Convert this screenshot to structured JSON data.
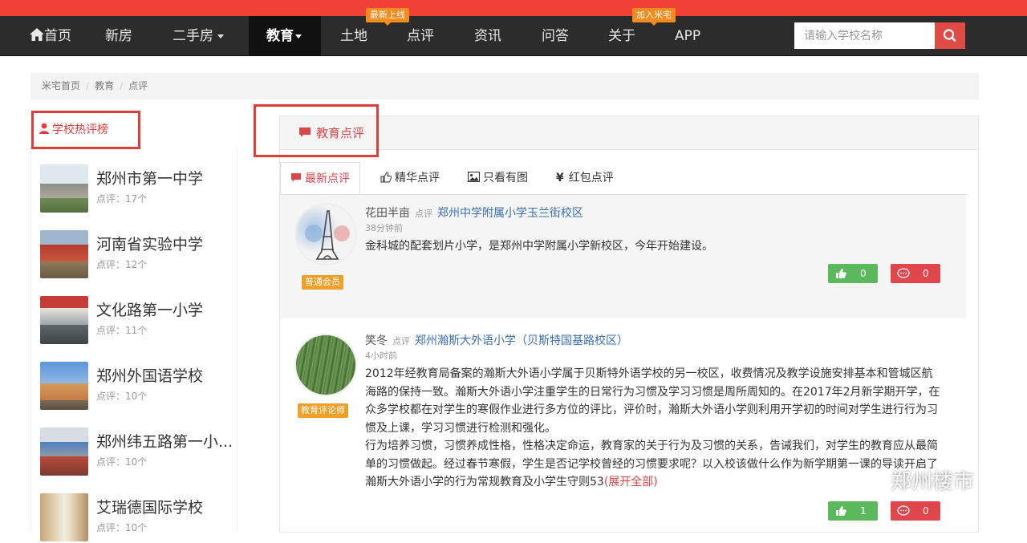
{
  "nav": {
    "home": "首页",
    "items": [
      "新房",
      "二手房",
      "教育",
      "土地",
      "点评",
      "资讯",
      "问答",
      "关于",
      "APP"
    ],
    "badges": {
      "tudi": "最新上线",
      "guanyu": "加入米宅"
    },
    "search_placeholder": "请输入学校名称"
  },
  "breadcrumb": [
    "米宅首页",
    "教育",
    "点评"
  ],
  "left": {
    "tab_label": "学校热评榜",
    "schools": [
      {
        "name": "郑州市第一中学",
        "count": "点评：17个"
      },
      {
        "name": "河南省实验中学",
        "count": "点评：12个"
      },
      {
        "name": "文化路第一小学",
        "count": "点评：11个"
      },
      {
        "name": "郑州外国语学校",
        "count": "点评：10个"
      },
      {
        "name": "郑州纬五路第一小...",
        "count": "点评：10个"
      },
      {
        "name": "艾瑞德国际学校",
        "count": "点评：10个"
      }
    ]
  },
  "right": {
    "tab_label": "教育点评",
    "subtabs": [
      "最新点评",
      "精华点评",
      "只看有图",
      "红包点评"
    ],
    "reviews": [
      {
        "user": "花田半亩",
        "tag": "点评",
        "school": "郑州中学附属小学玉兰街校区",
        "time": "38分钟前",
        "text": "金科城的配套划片小学，是郑州中学附属小学新校区，今年开始建设。",
        "role": "普通会员",
        "likes": "0",
        "comments": "0"
      },
      {
        "user": "笑冬",
        "tag": "点评",
        "school": "郑州瀚斯大外语小学（贝斯特国基路校区）",
        "time": "4小时前",
        "text": "2012年经教育局备案的瀚斯大外语小学属于贝斯特外语学校的另一校区，收费情况及教学设施安排基本和管城区航海路的保持一致。瀚斯大外语小学注重学生的日常行为习惯及学习习惯是周所周知的。在2017年2月新学期开学，在众多学校都在对学生的寒假作业进行多方位的评比，评价时，瀚斯大外语小学则利用开学初的时间对学生进行行为习惯及上课，学习习惯进行检测和强化。",
        "text2": "行为培养习惯，习惯养成性格，性格决定命运，教育家的关于行为及习惯的关系，告诫我们，对学生的教育应从最简单的习惯做起。经过春节寒假，学生是否记学校曾经的习惯要求呢？以入校该做什么作为新学期第一课的导读开启了瀚斯大外语小学的行为常规教育及小学生守则53",
        "more": "(展开全部)",
        "role": "教育评论师",
        "likes": "1",
        "comments": "0"
      }
    ]
  },
  "watermark": "郑州楼市",
  "colors": {
    "accent": "#e13c3c",
    "nav_bg": "#2c2c2c",
    "like": "#5cb85c",
    "comment": "#e0474c",
    "badge": "#f28c1e"
  }
}
